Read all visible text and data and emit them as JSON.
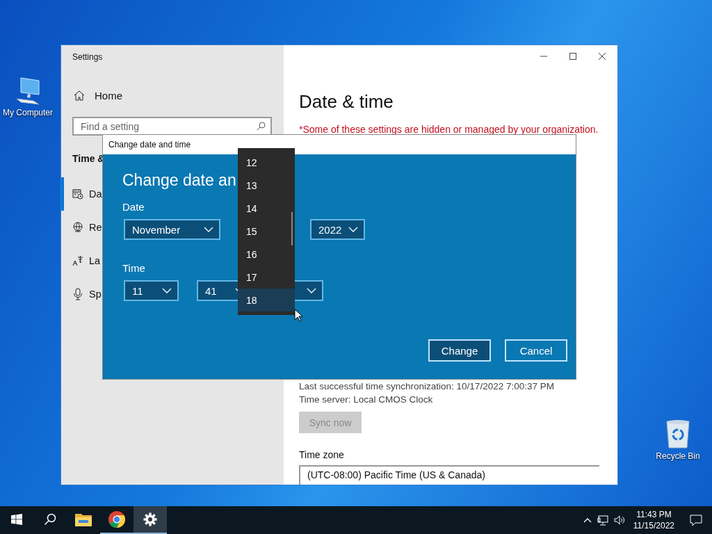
{
  "desktop_icons": [
    {
      "label": "My Computer",
      "kind": "computer"
    },
    {
      "label": "Recycle Bin",
      "kind": "recycle"
    }
  ],
  "settings_window": {
    "title": "Settings",
    "home": "Home",
    "search": {
      "placeholder": "Find a setting"
    },
    "section": "Time &",
    "nav": [
      {
        "label": "Da",
        "kind": "calendar",
        "selected": true
      },
      {
        "label": "Re",
        "kind": "globe",
        "selected": false
      },
      {
        "label": "La",
        "kind": "language",
        "selected": false
      },
      {
        "label": "Sp",
        "kind": "microphone",
        "selected": false
      }
    ],
    "heading": "Date & time",
    "notice": "*Some of these settings are hidden or managed by your organization.",
    "sync_info": [
      "Last successful time synchronization: 10/17/2022 7:00:37 PM",
      "Time server: Local CMOS Clock"
    ],
    "sync_button": {
      "label": "Sync now",
      "disabled": true
    },
    "time_zone": {
      "label": "Time zone",
      "value": "(UTC-08:00) Pacific Time (US & Canada)"
    }
  },
  "dialog": {
    "title": "Change date and time",
    "heading": "Change date an",
    "date_label": "Date",
    "month": "November",
    "year": "2022",
    "time_label": "Time",
    "hour": "11",
    "minute": "41",
    "buttons": [
      {
        "label": "Change",
        "kind": "primary"
      },
      {
        "label": "Cancel",
        "kind": "secondary"
      }
    ]
  },
  "dropdown": {
    "items": [
      {
        "label": "12",
        "selected": false
      },
      {
        "label": "13",
        "selected": false
      },
      {
        "label": "14",
        "selected": false
      },
      {
        "label": "15",
        "selected": false
      },
      {
        "label": "16",
        "selected": false
      },
      {
        "label": "17",
        "selected": false
      },
      {
        "label": "18",
        "selected": true
      }
    ]
  },
  "taskbar": {
    "apps": [
      {
        "kind": "explorer",
        "running": false,
        "selected": false
      },
      {
        "kind": "browser",
        "running": true,
        "selected": false
      },
      {
        "kind": "settings",
        "running": true,
        "selected": true
      }
    ],
    "time": "11:43 PM",
    "date": "11/15/2022"
  }
}
